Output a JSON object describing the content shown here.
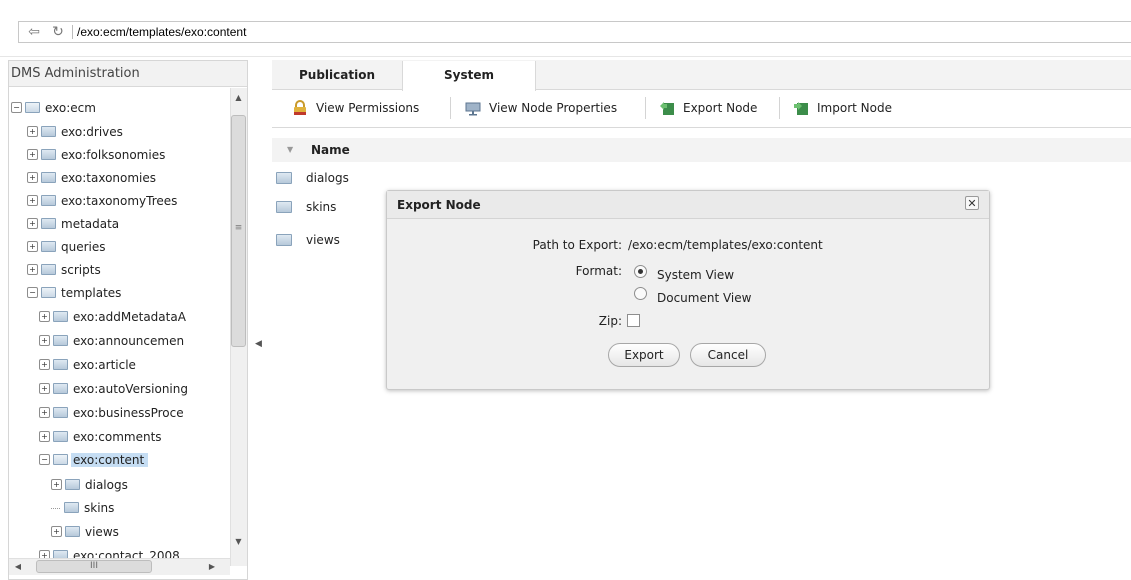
{
  "address_bar": {
    "path": "/exo:ecm/templates/exo:content",
    "back_icon": "back-arrow-icon",
    "refresh_icon": "refresh-icon"
  },
  "left_panel": {
    "title": "DMS Administration",
    "tree": [
      {
        "label": "exo:ecm",
        "expander": "⊖",
        "folder": "open"
      },
      {
        "label": "exo:drives",
        "expander": "⊕"
      },
      {
        "label": "exo:folksonomies",
        "expander": "⊕"
      },
      {
        "label": "exo:taxonomies",
        "expander": "⊕"
      },
      {
        "label": "exo:taxonomyTrees",
        "expander": "⊕"
      },
      {
        "label": "metadata",
        "expander": "⊕"
      },
      {
        "label": "queries",
        "expander": "⊕"
      },
      {
        "label": "scripts",
        "expander": "⊕"
      },
      {
        "label": "templates",
        "expander": "⊖",
        "folder": "open"
      },
      {
        "label": "exo:addMetadataA",
        "expander": "⊕"
      },
      {
        "label": "exo:announcemen",
        "expander": "⊕"
      },
      {
        "label": "exo:article",
        "expander": "⊕"
      },
      {
        "label": "exo:autoVersioning",
        "expander": "⊕"
      },
      {
        "label": "exo:businessProce",
        "expander": "⊕"
      },
      {
        "label": "exo:comments",
        "expander": "⊕"
      },
      {
        "label": "exo:content",
        "expander": "⊖",
        "folder": "open",
        "selected": true
      },
      {
        "label": "dialogs",
        "expander": "⊕"
      },
      {
        "label": "skins",
        "expander": ""
      },
      {
        "label": "views",
        "expander": "⊕"
      },
      {
        "label": "exo:contact_2008",
        "expander": "⊕"
      }
    ],
    "scrollbar_grip": "≡",
    "hscroll_grip": "III"
  },
  "tabs": [
    {
      "label": "Publication",
      "active": false
    },
    {
      "label": "System",
      "active": true
    }
  ],
  "toolbar": {
    "view_permissions": "View Permissions",
    "view_node_properties": "View Node Properties",
    "export_node": "Export Node",
    "import_node": "Import Node"
  },
  "list": {
    "column_name": "Name",
    "rows": [
      "dialogs",
      "skins",
      "views"
    ]
  },
  "dialog": {
    "title": "Export Node",
    "path_label": "Path to Export:",
    "path_value": "/exo:ecm/templates/exo:content",
    "format_label": "Format:",
    "format_options": [
      {
        "label": "System View",
        "checked": true
      },
      {
        "label": "Document View",
        "checked": false
      }
    ],
    "zip_label": "Zip:",
    "zip_checked": false,
    "export_button": "Export",
    "cancel_button": "Cancel",
    "close_glyph": "✕"
  },
  "colors": {
    "selection": "#c5ddf3",
    "panel_header": "#f2f2f2",
    "dialog_bg": "#f0f0f0"
  }
}
